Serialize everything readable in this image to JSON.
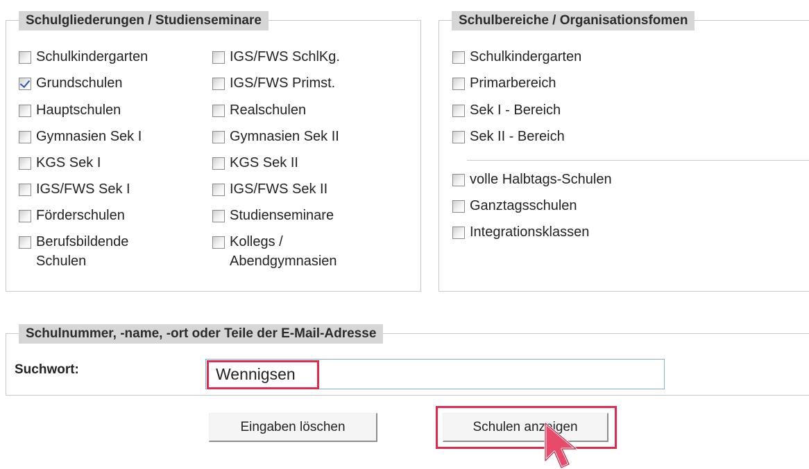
{
  "school_types": {
    "legend": "Schulgliederungen / Studienseminare",
    "left_column": [
      {
        "label": "Schulkindergarten",
        "checked": false
      },
      {
        "label": "Grundschulen",
        "checked": true
      },
      {
        "label": "Hauptschulen",
        "checked": false
      },
      {
        "label": "Gymnasien Sek I",
        "checked": false
      },
      {
        "label": "KGS Sek I",
        "checked": false
      },
      {
        "label": "IGS/FWS Sek I",
        "checked": false
      },
      {
        "label": "Förderschulen",
        "checked": false
      },
      {
        "label_line1": "Berufsbildende",
        "label_line2": "Schulen",
        "checked": false
      }
    ],
    "right_column": [
      {
        "label": "IGS/FWS SchlKg.",
        "checked": false
      },
      {
        "label": "IGS/FWS Primst.",
        "checked": false
      },
      {
        "label": "Realschulen",
        "checked": false
      },
      {
        "label": "Gymnasien Sek II",
        "checked": false
      },
      {
        "label": "KGS Sek II",
        "checked": false
      },
      {
        "label": "IGS/FWS Sek II",
        "checked": false
      },
      {
        "label": "Studienseminare",
        "checked": false
      },
      {
        "label_line1": "Kollegs /",
        "label_line2": "Abendgymnasien",
        "checked": false
      }
    ]
  },
  "school_areas": {
    "legend": "Schulbereiche / Organisationsfomen",
    "areas": [
      {
        "label": "Schulkindergarten",
        "checked": false
      },
      {
        "label": "Primarbereich",
        "checked": false
      },
      {
        "label": "Sek I - Bereich",
        "checked": false
      },
      {
        "label": "Sek II - Bereich",
        "checked": false
      }
    ],
    "forms": [
      {
        "label": "volle Halbtags-Schulen",
        "checked": false
      },
      {
        "label": "Ganztagsschulen",
        "checked": false
      },
      {
        "label": "Integrationsklassen",
        "checked": false
      }
    ]
  },
  "search": {
    "legend": "Schulnummer, -name, -ort oder Teile der E-Mail-Adresse",
    "label": "Suchwort:",
    "value": "Wennigsen"
  },
  "buttons": {
    "clear_label": "Eingaben löschen",
    "show_label": "Schulen anzeigen"
  },
  "colors": {
    "legend_bg": "#d6d6d6",
    "highlight": "#e02a4f",
    "input_border": "#7fb1d8",
    "check_mark": "#2a55b8"
  },
  "icons": {
    "cursor": "mouse-pointer-icon"
  }
}
